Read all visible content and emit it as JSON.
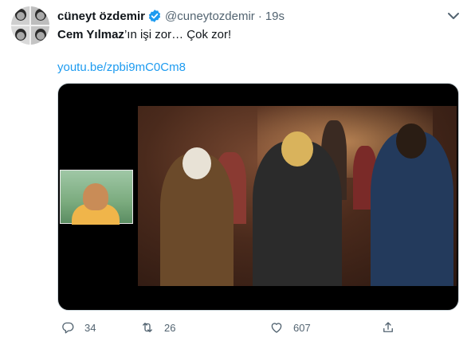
{
  "tweet": {
    "author_name": "cüneyt özdemir",
    "handle": "@cuneytozdemir",
    "separator": "·",
    "time": "19s",
    "text_bold": "Cem Yılmaz",
    "text_rest": "’ın işi zor… Çok zor!",
    "link": "youtu.be/zpbi9mC0Cm8"
  },
  "actions": {
    "replies": "34",
    "retweets": "26",
    "likes": "607"
  },
  "icons": {
    "verified": "verified-badge-icon",
    "more": "more-chevron-icon",
    "reply": "reply-icon",
    "retweet": "retweet-icon",
    "like": "heart-icon",
    "share": "share-icon"
  },
  "colors": {
    "link": "#1d9bf0",
    "verified": "#1d9bf0",
    "muted": "#536471"
  }
}
